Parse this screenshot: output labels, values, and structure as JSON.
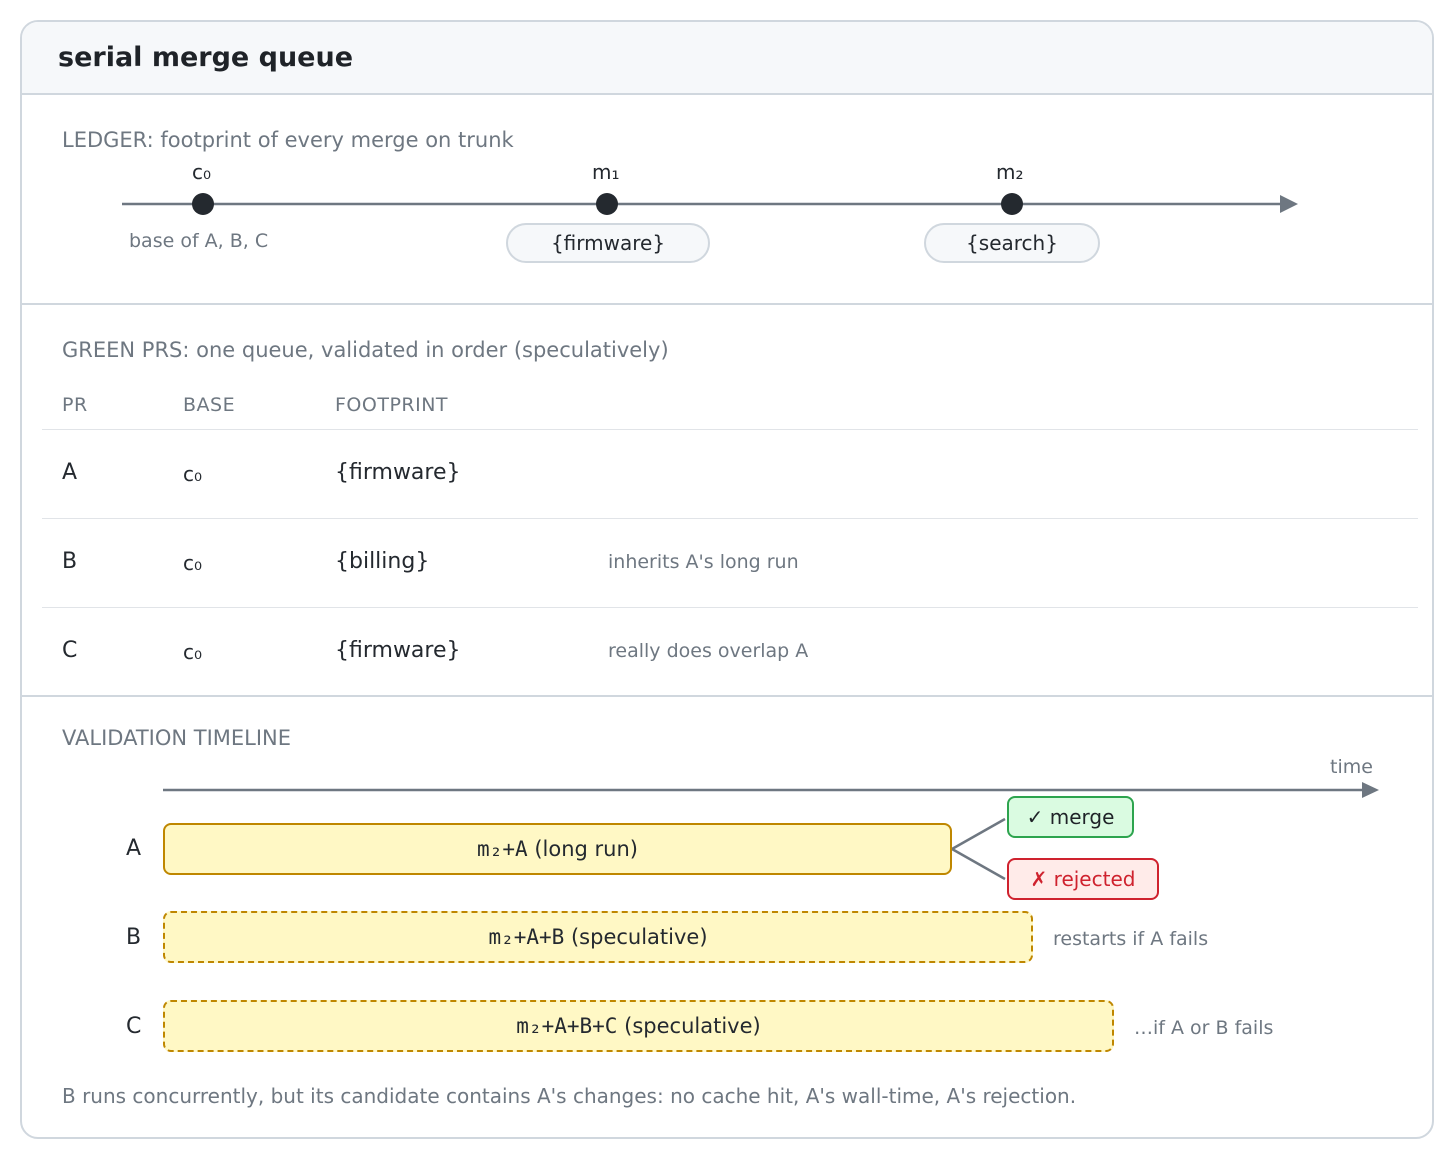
{
  "header": {
    "title": "serial merge queue"
  },
  "ledger": {
    "label": "LEDGER: footprint of every merge on trunk",
    "commits": [
      {
        "name": "c₀",
        "caption": "base of A, B, C",
        "tag": ""
      },
      {
        "name": "m₁",
        "caption": "",
        "tag": "{firmware}"
      },
      {
        "name": "m₂",
        "caption": "",
        "tag": "{search}"
      }
    ]
  },
  "green_prs": {
    "label": "GREEN PRS: one queue, validated in order (speculatively)",
    "columns": [
      "PR",
      "BASE",
      "FOOTPRINT"
    ],
    "rows": [
      {
        "pr": "A",
        "base": "c₀",
        "footprint": "{firmware}",
        "note": ""
      },
      {
        "pr": "B",
        "base": "c₀",
        "footprint": "{billing}",
        "note": "inherits A's long run"
      },
      {
        "pr": "C",
        "base": "c₀",
        "footprint": "{firmware}",
        "note": "really does overlap A"
      }
    ]
  },
  "timeline": {
    "label": "VALIDATION TIMELINE",
    "axis_label": "time",
    "lanes": [
      {
        "pr": "A",
        "candidate": "m₂+A",
        "desc": "(long run)",
        "style": "solid",
        "note": ""
      },
      {
        "pr": "B",
        "candidate": "m₂+A+B",
        "desc": "(speculative)",
        "style": "dashed",
        "note": "restarts if A fails"
      },
      {
        "pr": "C",
        "candidate": "m₂+A+B+C",
        "desc": "(speculative)",
        "style": "dashed",
        "note": "…if A or B fails"
      }
    ],
    "outcomes": {
      "merge": "✓ merge",
      "rejected": "✗ rejected"
    },
    "footnote": "B runs concurrently, but its candidate contains A's changes: no cache hit, A's wall-time, A's rejection."
  },
  "colors": {
    "bar_fill": "#fff8c5",
    "bar_stroke": "#bf8700",
    "ok": "#2da44e",
    "bad": "#cf222e",
    "axis": "#6e7781"
  }
}
